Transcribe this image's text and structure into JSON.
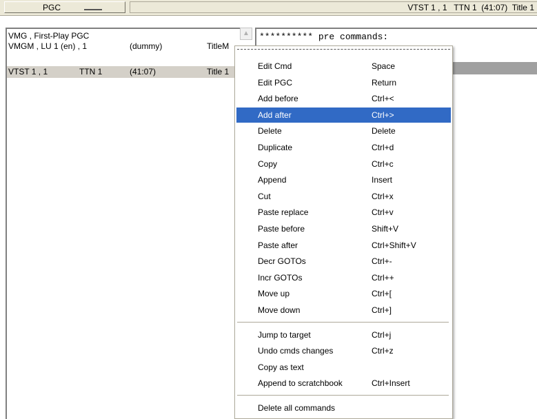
{
  "header": {
    "pgc_button_label": "PGC",
    "title": "VTST 1 , 1   TTN 1  (41:07)  Title 1"
  },
  "pgc_list": {
    "rows": [
      {
        "c1": "VMG , First-Play PGC",
        "c2": "",
        "c3": ""
      },
      {
        "c1": "VMGM , LU 1 (en) , 1",
        "c2": "(dummy)",
        "c3": "TitleM"
      },
      {
        "c1": "VTST 1 , 1",
        "c1b": "TTN 1",
        "c2": "(41:07)",
        "c3": "Title 1"
      }
    ]
  },
  "command_area": {
    "line1": "********** pre commands:"
  },
  "context_menu": {
    "groups": [
      [
        {
          "label": "Edit Cmd",
          "shortcut": "Space"
        },
        {
          "label": "Edit PGC",
          "shortcut": "Return"
        },
        {
          "label": "Add before",
          "shortcut": "Ctrl+<"
        },
        {
          "label": "Add after",
          "shortcut": "Ctrl+>"
        },
        {
          "label": "Delete",
          "shortcut": "Delete"
        },
        {
          "label": "Duplicate",
          "shortcut": "Ctrl+d"
        },
        {
          "label": "Copy",
          "shortcut": "Ctrl+c"
        },
        {
          "label": "Append",
          "shortcut": "Insert"
        },
        {
          "label": "Cut",
          "shortcut": "Ctrl+x"
        },
        {
          "label": "Paste replace",
          "shortcut": "Ctrl+v"
        },
        {
          "label": "Paste before",
          "shortcut": "Shift+V"
        },
        {
          "label": "Paste after",
          "shortcut": "Ctrl+Shift+V"
        },
        {
          "label": "Decr GOTOs",
          "shortcut": "Ctrl+-"
        },
        {
          "label": "Incr GOTOs",
          "shortcut": "Ctrl++"
        },
        {
          "label": "Move up",
          "shortcut": "Ctrl+["
        },
        {
          "label": "Move down",
          "shortcut": "Ctrl+]"
        }
      ],
      [
        {
          "label": "Jump to target",
          "shortcut": "Ctrl+j"
        },
        {
          "label": "Undo cmds changes",
          "shortcut": "Ctrl+z"
        },
        {
          "label": "Copy as text",
          "shortcut": ""
        },
        {
          "label": "Append to scratchbook",
          "shortcut": "Ctrl+Insert"
        }
      ],
      [
        {
          "label": "Delete all commands",
          "shortcut": ""
        }
      ]
    ],
    "highlighted": "Add after"
  },
  "colors": {
    "menu_highlight": "#316ac5",
    "selected_row": "#d4d0c8",
    "chrome": "#ece9d8"
  }
}
